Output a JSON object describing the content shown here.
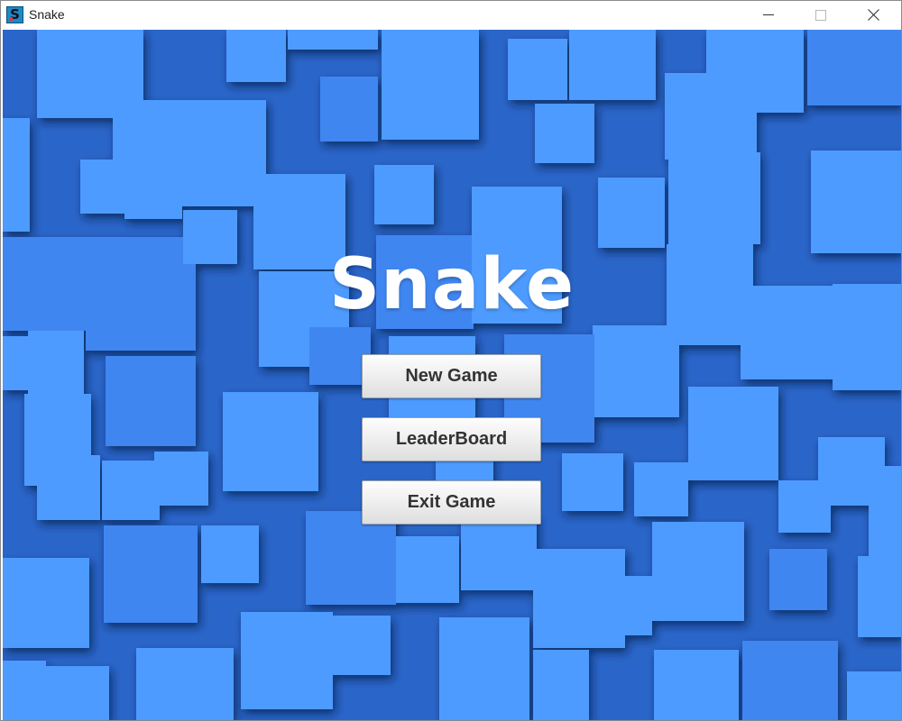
{
  "window": {
    "title": "Snake",
    "app_icon_letter": "S",
    "controls": {
      "minimize": "minimize-icon",
      "maximize": "maximize-icon",
      "close": "close-icon"
    }
  },
  "menu": {
    "game_title": "Snake",
    "buttons": [
      {
        "label": "New Game"
      },
      {
        "label": "LeaderBoard"
      },
      {
        "label": "Exit Game"
      }
    ]
  },
  "colors": {
    "background_dark": "#2a66c9",
    "tile_light": "#4e9bff",
    "tile_mid": "#3f86f0",
    "title_text": "#ffffff",
    "button_text": "#333333"
  }
}
